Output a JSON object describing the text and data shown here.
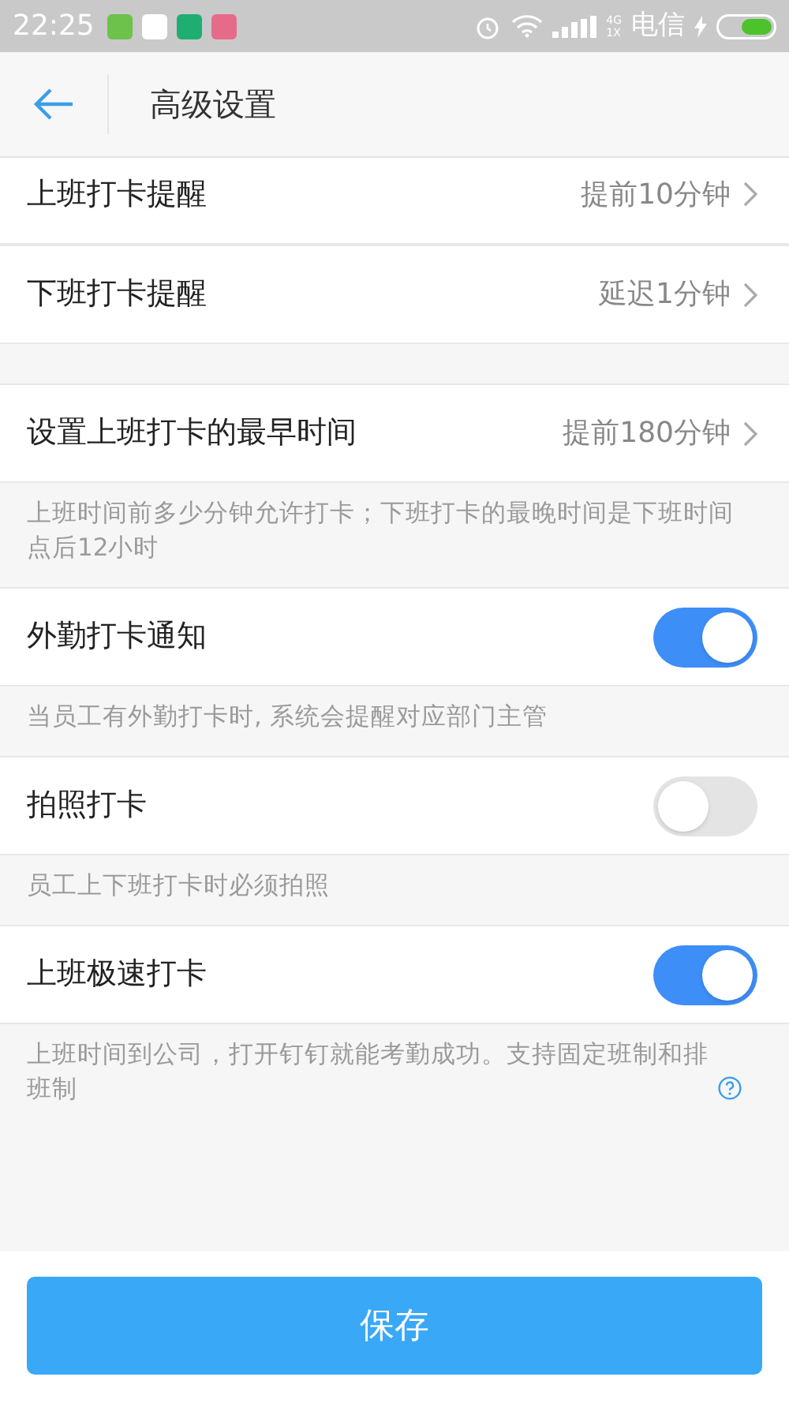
{
  "status_bar": {
    "time": "22:25",
    "network": [
      "4G",
      "1X"
    ],
    "carrier": "电信"
  },
  "header": {
    "title": "高级设置"
  },
  "groups": [
    {
      "rows": [
        {
          "kind": "value",
          "label": "上班打卡提醒",
          "value": "提前10分钟"
        },
        {
          "kind": "value",
          "label": "下班打卡提醒",
          "value": "延迟1分钟"
        }
      ]
    },
    {
      "rows": [
        {
          "kind": "value",
          "label": "设置上班打卡的最早时间",
          "value": "提前180分钟"
        }
      ],
      "hint": "上班时间前多少分钟允许打卡；下班打卡的最晚时间是下班时间点后12小时"
    },
    {
      "rows": [
        {
          "kind": "toggle",
          "label": "外勤打卡通知",
          "on": true
        }
      ],
      "hint": "当员工有外勤打卡时, 系统会提醒对应部门主管"
    },
    {
      "rows": [
        {
          "kind": "toggle",
          "label": "拍照打卡",
          "on": false
        }
      ],
      "hint": "员工上下班打卡时必须拍照"
    },
    {
      "rows": [
        {
          "kind": "toggle",
          "label": "上班极速打卡",
          "on": true
        }
      ],
      "hint": "上班时间到公司，打开钉钉就能考勤成功。支持固定班制和排班制",
      "help": true
    }
  ],
  "save_button": "保存"
}
